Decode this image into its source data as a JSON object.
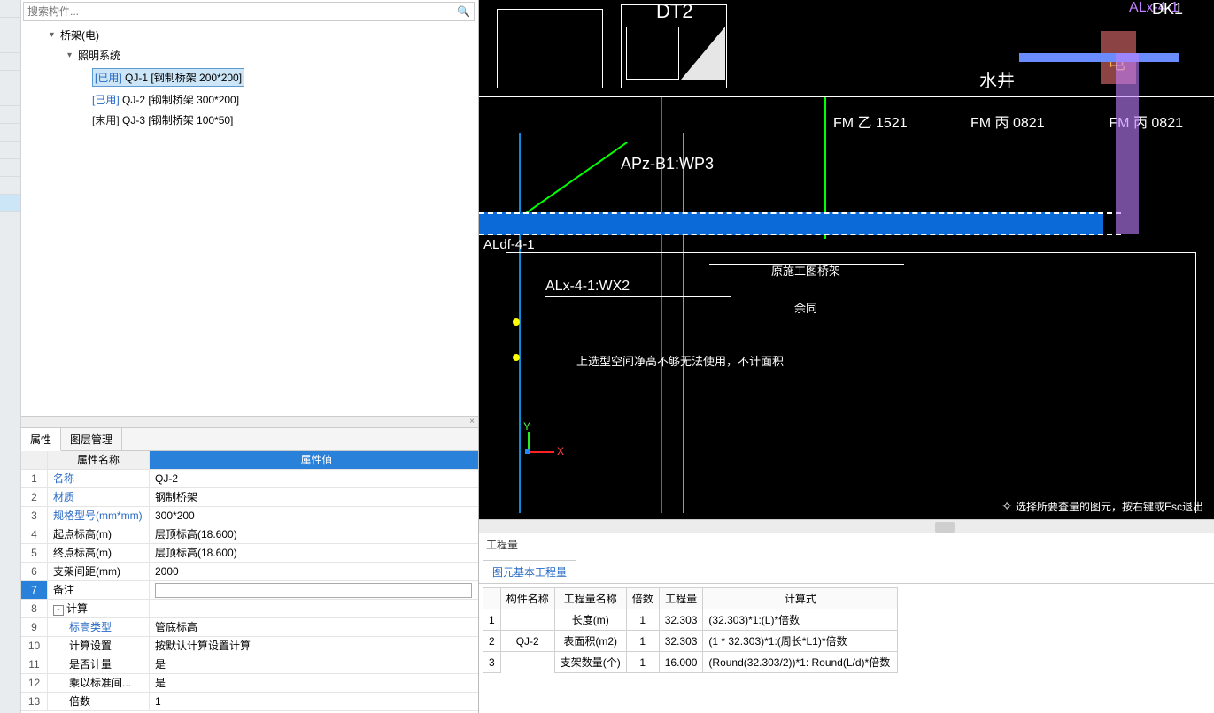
{
  "search": {
    "placeholder": "搜索构件..."
  },
  "tree": {
    "root": "桥架(电)",
    "sub": "照明系统",
    "items": [
      {
        "tag": "[已用]",
        "used": true,
        "label": "QJ-1 [钢制桥架 200*200]"
      },
      {
        "tag": "[已用]",
        "used": true,
        "label": "QJ-2 [钢制桥架 300*200]"
      },
      {
        "tag": "[末用]",
        "used": false,
        "label": "QJ-3 [钢制桥架 100*50]"
      }
    ]
  },
  "tabs": {
    "prop": "属性",
    "layer": "图层管理"
  },
  "prop": {
    "header_name": "属性名称",
    "header_val": "属性值",
    "rows": [
      {
        "n": "1",
        "name": "名称",
        "val": "QJ-2",
        "link": true
      },
      {
        "n": "2",
        "name": "材质",
        "val": "钢制桥架",
        "link": true
      },
      {
        "n": "3",
        "name": "规格型号(mm*mm)",
        "val": "300*200",
        "link": true
      },
      {
        "n": "4",
        "name": "起点标高(m)",
        "val": "层顶标高(18.600)"
      },
      {
        "n": "5",
        "name": "终点标高(m)",
        "val": "层顶标高(18.600)"
      },
      {
        "n": "6",
        "name": "支架间距(mm)",
        "val": "2000"
      },
      {
        "n": "7",
        "name": "备注",
        "val": "",
        "edit": true
      },
      {
        "n": "8",
        "name": "计算",
        "val": "",
        "group": true
      },
      {
        "n": "9",
        "name": "标高类型",
        "val": "管底标高",
        "link": true,
        "indent": true
      },
      {
        "n": "10",
        "name": "计算设置",
        "val": "按默认计算设置计算",
        "indent": true
      },
      {
        "n": "11",
        "name": "是否计量",
        "val": "是",
        "indent": true
      },
      {
        "n": "12",
        "name": "乘以标准间...",
        "val": "是",
        "indent": true
      },
      {
        "n": "13",
        "name": "倍数",
        "val": "1",
        "indent": true
      }
    ]
  },
  "canvas": {
    "hint": "选择所要查量的图元，按右键或Esc退出",
    "labels": {
      "dt2": "DT2",
      "dk1": "DK1",
      "alx41top": "ALx-4-1",
      "shui": "水井",
      "dian": "电",
      "fmz": "FM 乙 1521",
      "fmb1": "FM 丙 0821",
      "fmb2": "FM 丙 0821",
      "apz": "APz-B1:WP3",
      "aldf": "ALdf-4-1",
      "alxwx2": "ALx-4-1:WX2",
      "yuanshi": "原施工图桥架",
      "yutong": "余同",
      "note1": "上选型空间净高不够无法使用，不计面积",
      "axis_x": "X",
      "axis_y": "Y"
    }
  },
  "result": {
    "title": "工程量",
    "tab": "图元基本工程量",
    "headers": {
      "idx": "",
      "comp": "构件名称",
      "qname": "工程量名称",
      "mult": "倍数",
      "qty": "工程量",
      "formula": "计算式"
    },
    "comp": "QJ-2",
    "rows": [
      {
        "i": "1",
        "qname": "长度(m)",
        "mult": "1",
        "qty": "32.303",
        "formula": "(32.303)*1:(L)*倍数"
      },
      {
        "i": "2",
        "qname": "表面积(m2)",
        "mult": "1",
        "qty": "32.303",
        "formula": "(1 * 32.303)*1:(周长*L1)*倍数"
      },
      {
        "i": "3",
        "qname": "支架数量(个)",
        "mult": "1",
        "qty": "16.000",
        "formula": "(Round(32.303/2))*1: Round(L/d)*倍数"
      }
    ]
  }
}
